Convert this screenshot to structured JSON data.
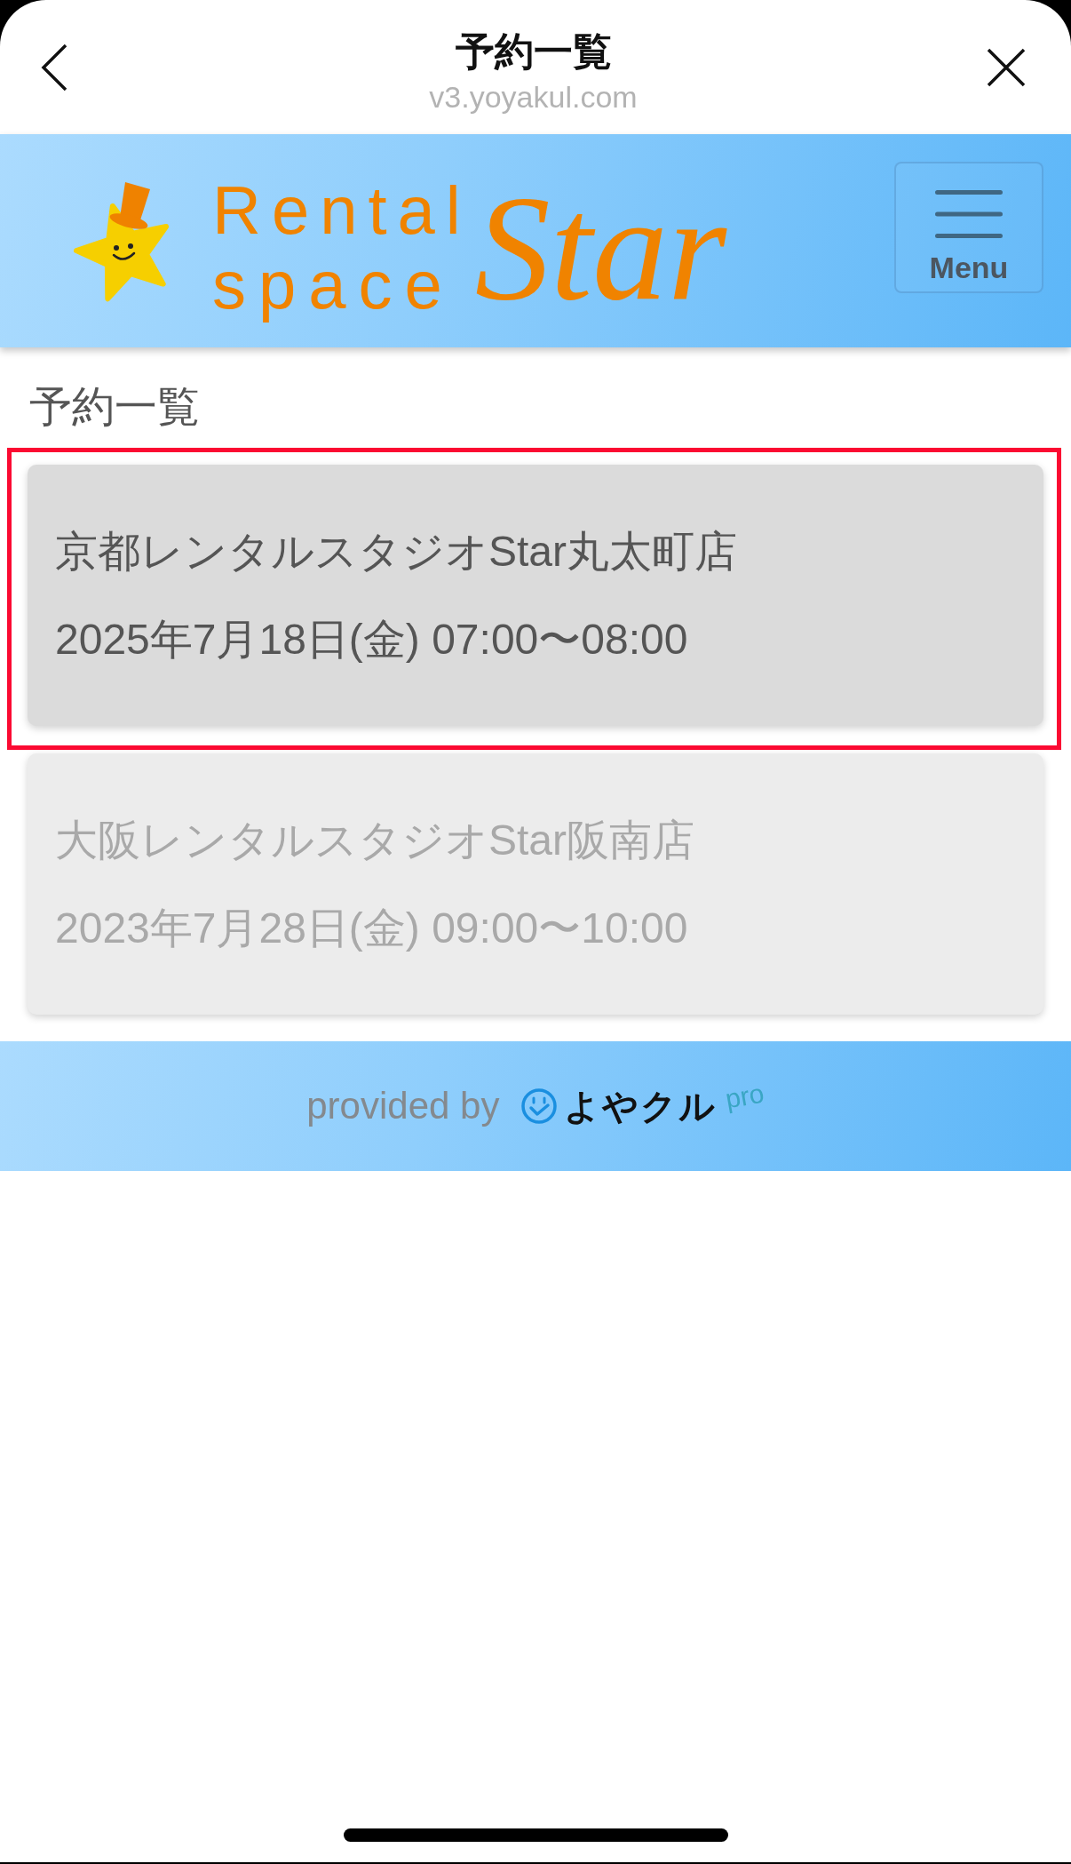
{
  "top_bar": {
    "title": "予約一覧",
    "url": "v3.yoyakul.com"
  },
  "header": {
    "logo": {
      "line_1": "Rental",
      "line_2": "space",
      "word": "Star"
    },
    "menu_button": {
      "label": "Menu"
    }
  },
  "page_title": "予約一覧",
  "reservations": [
    {
      "studio": "京都レンタルスタジオStar丸太町店",
      "time": "2025年7月18日(金) 07:00〜08:00",
      "selected": true,
      "disabled": false
    },
    {
      "studio": "大阪レンタルスタジオStar阪南店",
      "time": "2023年7月28日(金) 09:00〜10:00",
      "selected": false,
      "disabled": true
    }
  ],
  "footer": {
    "provided_by": "provided by",
    "brand": "よやクル",
    "brand_suffix": "pro"
  }
}
